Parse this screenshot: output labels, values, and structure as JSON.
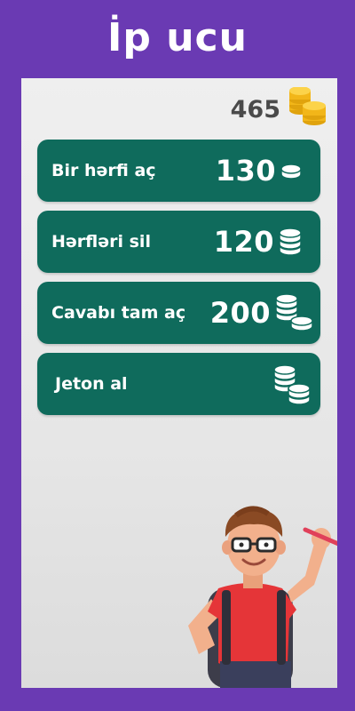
{
  "header": {
    "title": "İp ucu"
  },
  "balance": {
    "count": "465",
    "icon": "gold-coins-icon"
  },
  "hints": [
    {
      "label": "Bir hərfi aç",
      "price": "130",
      "icon": "single-coin-icon"
    },
    {
      "label": "Hərfləri sil",
      "price": "120",
      "icon": "coin-stack-icon"
    },
    {
      "label": "Cavabı tam aç",
      "price": "200",
      "icon": "coin-stacks-icon"
    },
    {
      "label": "Jeton al",
      "price": "",
      "icon": "coin-stacks-icon"
    }
  ],
  "colors": {
    "background": "#6a3ab3",
    "button": "#0f6b5c",
    "coin_gold": "#f2b619",
    "coin_white": "#ffffff",
    "text_dark": "#4a4a4a"
  },
  "illustration": {
    "name": "student-character-illustration"
  }
}
